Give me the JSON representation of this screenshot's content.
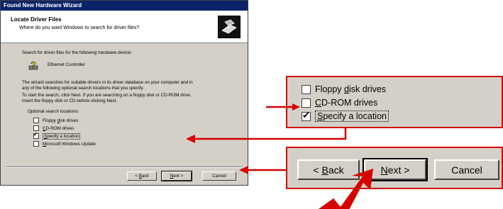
{
  "window": {
    "title": "Found New Hardware Wizard",
    "header_title": "Locate Driver Files",
    "header_subtitle": "Where do you want Windows to search for driver files?"
  },
  "body": {
    "intro": "Search for driver files for the following hardware device:",
    "device_name": "Ethernet Controller",
    "para1_line1": "The wizard searches for suitable drivers in its driver database on your computer and in",
    "para1_line2": "any of the following optional search locations that you specify.",
    "para2_line1": "To start the search, click Next. If you are searching on a floppy disk or CD-ROM drive,",
    "para2_line2": "insert the floppy disk or CD before clicking Next.",
    "options_label": "Optional search locations:",
    "options": [
      {
        "pre": "Floppy ",
        "key": "d",
        "post": "isk drives",
        "checked": false
      },
      {
        "pre": "",
        "key": "C",
        "post": "D-ROM drives",
        "checked": false
      },
      {
        "pre": "",
        "key": "S",
        "post": "pecify a location",
        "checked": true
      },
      {
        "pre": "",
        "key": "M",
        "post": "icrosoft Windows Update",
        "checked": false
      }
    ]
  },
  "buttons": {
    "back_pre": "< ",
    "back_key": "B",
    "back_post": "ack",
    "next_key": "N",
    "next_post": "ext >",
    "cancel": "Cancel"
  },
  "colors": {
    "title_bar": "#0a246a",
    "callout_red": "#d60000",
    "dialog_gray": "#d4d0c8"
  }
}
